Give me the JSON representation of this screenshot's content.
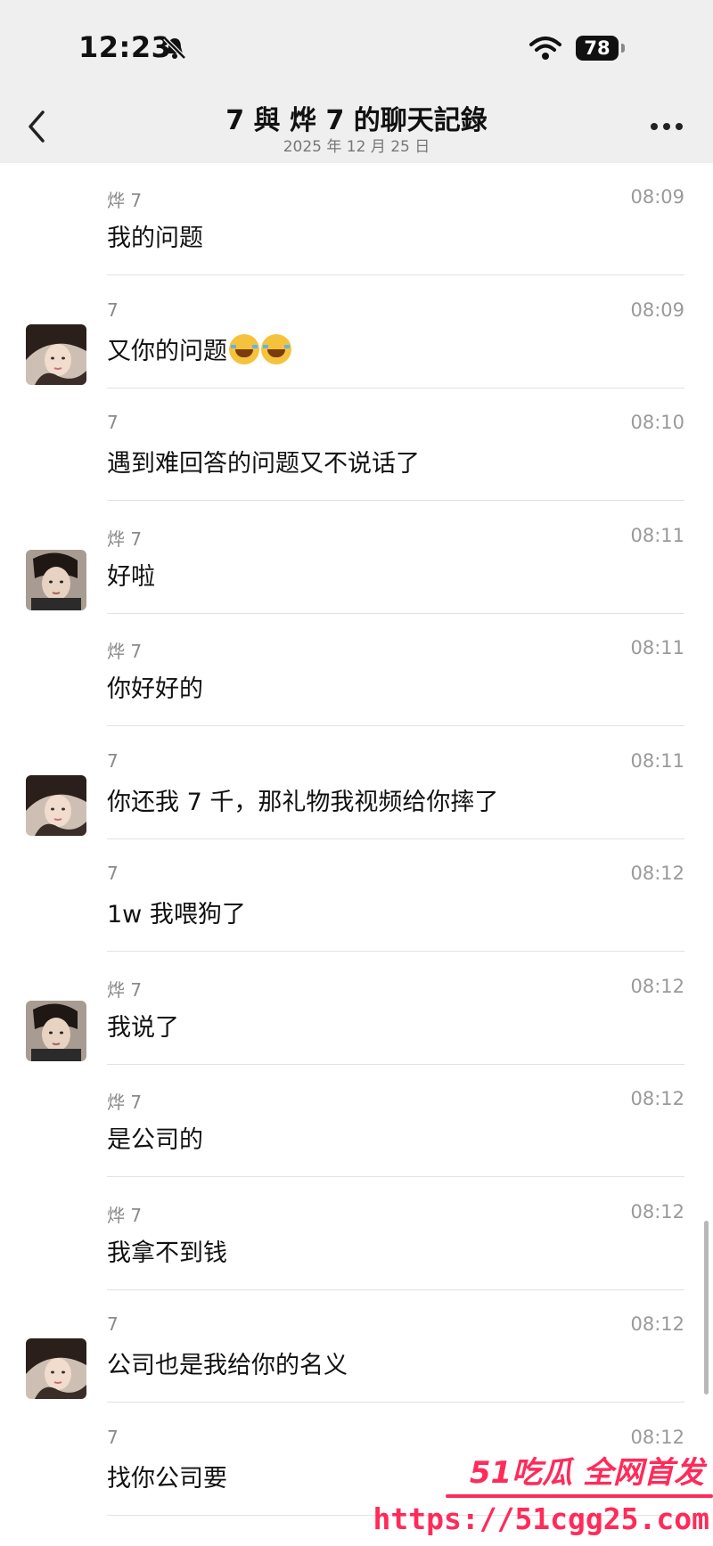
{
  "status": {
    "time": "12:23",
    "battery": "78"
  },
  "nav": {
    "title": "7 與 烨 7 的聊天記錄",
    "subtitle": "2025 年 12 月 25 日"
  },
  "messages": [
    {
      "sender": "烨 7",
      "time": "08:09",
      "text": "我的问题",
      "avatar": "none"
    },
    {
      "sender": "7",
      "time": "08:09",
      "text": "又你的问题",
      "emoji": "joy-emoji",
      "avatar": "girl"
    },
    {
      "sender": "7",
      "time": "08:10",
      "text": "遇到难回答的问题又不说话了",
      "avatar": "none"
    },
    {
      "sender": "烨 7",
      "time": "08:11",
      "text": "好啦",
      "avatar": "boy"
    },
    {
      "sender": "烨 7",
      "time": "08:11",
      "text": "你好好的",
      "avatar": "none"
    },
    {
      "sender": "7",
      "time": "08:11",
      "text": "你还我 7 千，那礼物我视频给你摔了",
      "avatar": "girl"
    },
    {
      "sender": "7",
      "time": "08:12",
      "text": "1w 我喂狗了",
      "avatar": "none"
    },
    {
      "sender": "烨 7",
      "time": "08:12",
      "text": "我说了",
      "avatar": "boy"
    },
    {
      "sender": "烨 7",
      "time": "08:12",
      "text": "是公司的",
      "avatar": "none"
    },
    {
      "sender": "烨 7",
      "time": "08:12",
      "text": "我拿不到钱",
      "avatar": "none"
    },
    {
      "sender": "7",
      "time": "08:12",
      "text": "公司也是我给你的名义",
      "avatar": "girl"
    },
    {
      "sender": "7",
      "time": "08:12",
      "text": "找你公司要",
      "avatar": "none"
    }
  ],
  "watermark": {
    "brand": "51吃瓜 全网首发",
    "url": "https://51cgg25.com"
  },
  "colors": {
    "header_bg": "#efefef",
    "watermark": "#ff2b5a"
  }
}
